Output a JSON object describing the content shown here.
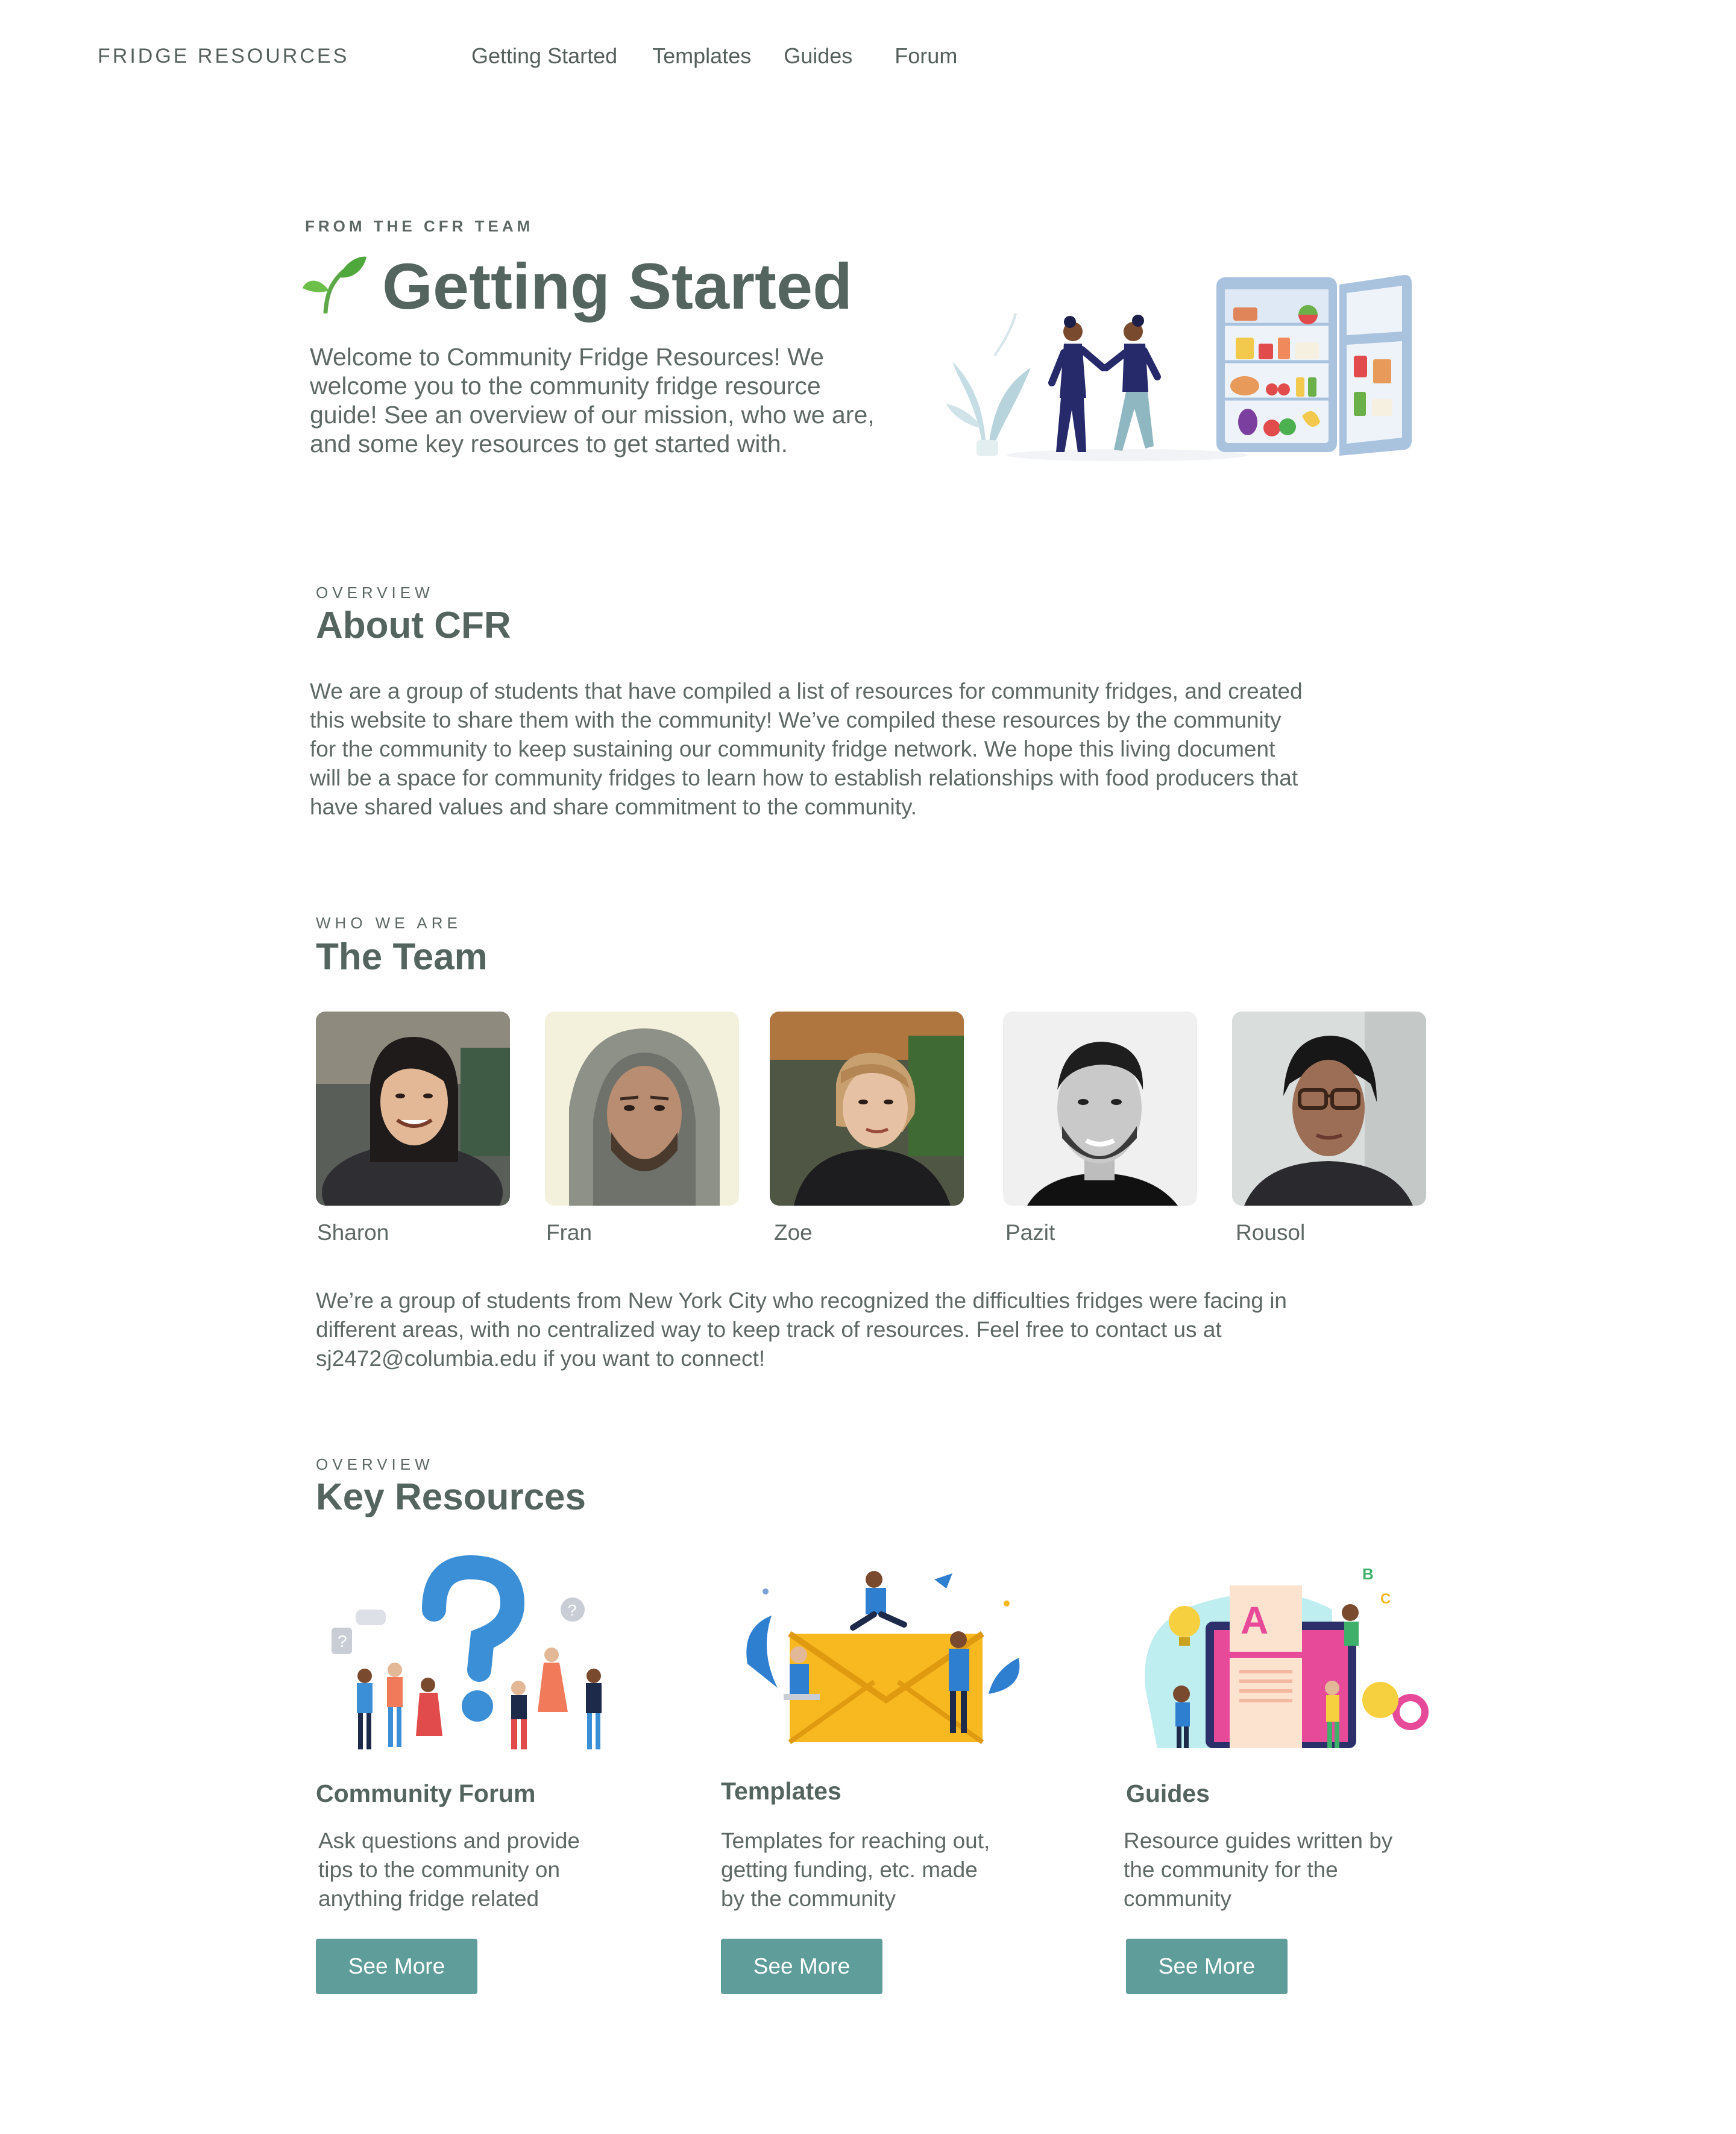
{
  "nav": {
    "brand": "FRIDGE RESOURCES",
    "links": [
      "Getting Started",
      "Templates",
      "Guides",
      "Forum"
    ]
  },
  "hero": {
    "eyebrow": "FROM THE CFR TEAM",
    "title": "Getting Started",
    "intro_lines": [
      "Welcome to Community Fridge Resources! We",
      "welcome you to the community fridge resource",
      "guide! See an overview of our mission, who we are,",
      "and some key resources to get started with."
    ]
  },
  "about": {
    "eyebrow": "OVERVIEW",
    "title": "About CFR",
    "lines": [
      "We are a group of students that have compiled a list of resources for community fridges, and created",
      "this website to share them with the community! We’ve compiled these resources by the community",
      "for the community to keep sustaining our community fridge network. We hope this living document",
      "will be a space for community fridges to learn how to establish relationships with food producers that",
      "have shared values and share commitment to the community."
    ]
  },
  "team": {
    "eyebrow": "WHO WE ARE",
    "title": "The Team",
    "members": [
      {
        "name": "Sharon"
      },
      {
        "name": "Fran"
      },
      {
        "name": "Zoe"
      },
      {
        "name": "Pazit"
      },
      {
        "name": "Rousol"
      }
    ],
    "desc_lines": [
      "We’re a group of students from New York City who recognized the difficulties fridges were facing in",
      "different areas, with no centralized way to keep track of resources. Feel free to contact us at",
      "sj2472@columbia.edu if you want to connect!"
    ]
  },
  "resources": {
    "eyebrow": "OVERVIEW",
    "title": "Key Resources",
    "items": [
      {
        "title": "Community Forum",
        "desc_lines": [
          "Ask questions and provide",
          "tips to the community on",
          "anything fridge related"
        ],
        "button": "See More"
      },
      {
        "title": "Templates",
        "desc_lines": [
          "Templates for reaching out,",
          "getting funding, etc. made",
          "by the community"
        ],
        "button": "See More"
      },
      {
        "title": "Guides",
        "desc_lines": [
          "Resource guides written by",
          "the community for the",
          "community"
        ],
        "button": "See More"
      }
    ]
  },
  "colors": {
    "heading": "#54645f",
    "body": "#5e6865",
    "button": "#5f9d9a",
    "accent_teal": "#4fa8a4"
  }
}
